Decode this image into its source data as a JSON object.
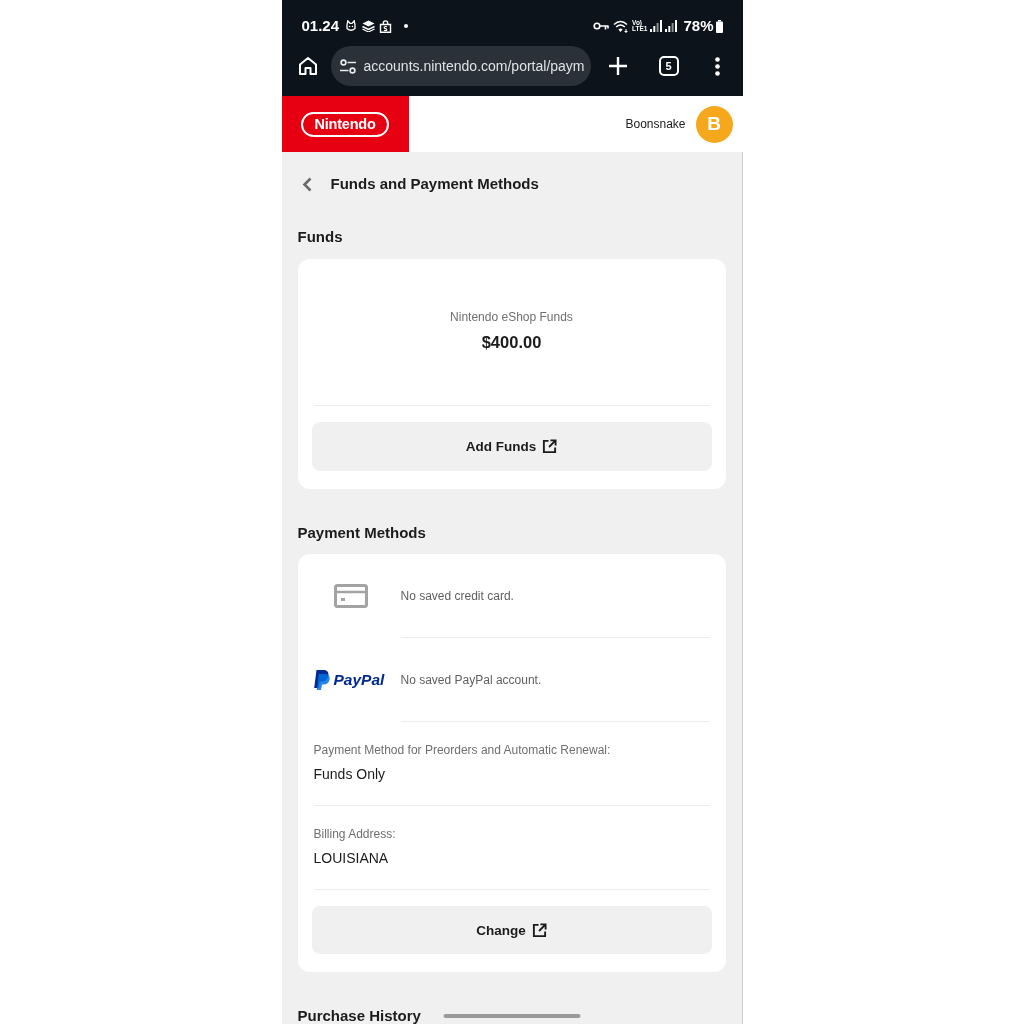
{
  "status_bar": {
    "time": "01.24",
    "network_type": [
      "Vo)",
      "LTE1"
    ],
    "battery": "78%"
  },
  "browser_toolbar": {
    "url": "accounts.nintendo.com/portal/paym",
    "tab_count": "5"
  },
  "header": {
    "logo": "Nintendo",
    "username": "Boonsnake",
    "avatar_letter": "B"
  },
  "page": {
    "title": "Funds and Payment Methods"
  },
  "funds": {
    "heading": "Funds",
    "label": "Nintendo eShop Funds",
    "amount": "$400.00",
    "button": "Add Funds"
  },
  "payment_methods": {
    "heading": "Payment Methods",
    "methods": [
      {
        "kind": "card",
        "text": "No saved credit card."
      },
      {
        "kind": "paypal",
        "logo": "PayPal",
        "text": "No saved PayPal account."
      }
    ],
    "details": [
      {
        "label": "Payment Method for Preorders and Automatic Renewal:",
        "value": "Funds Only"
      },
      {
        "label": "Billing Address:",
        "value": "LOUISIANA"
      }
    ],
    "button": "Change"
  },
  "purchase_history": {
    "heading": "Purchase History"
  }
}
